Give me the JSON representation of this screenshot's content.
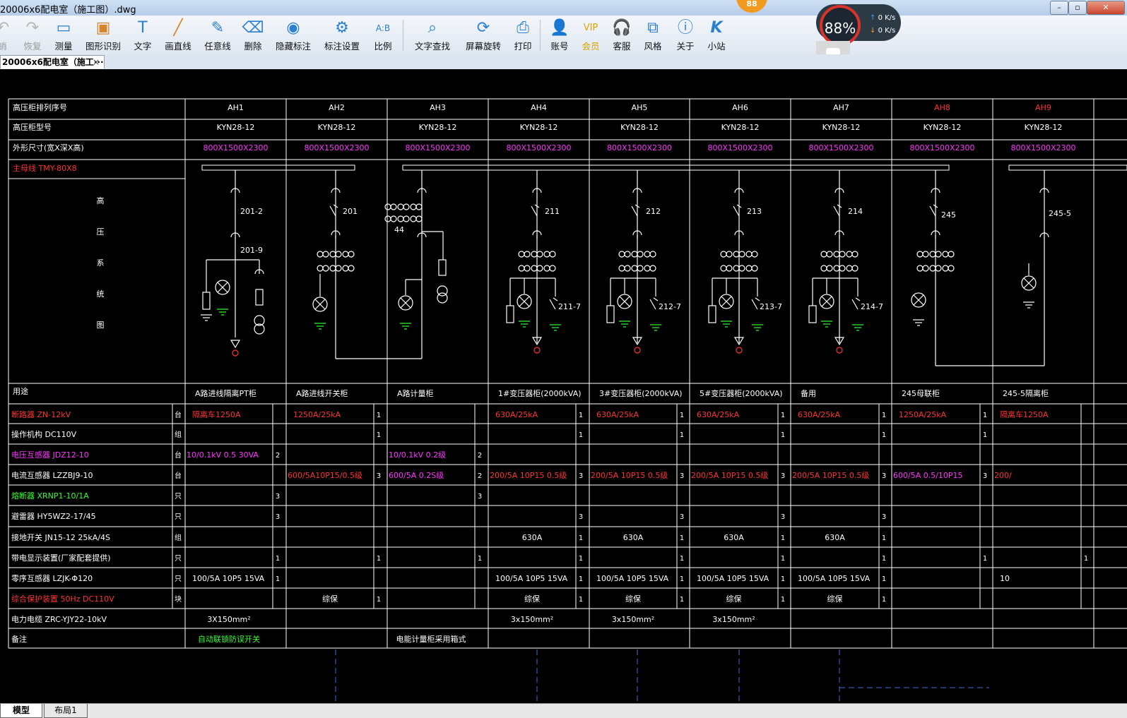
{
  "window": {
    "title": "20006x6配电室（施工图）.dwg"
  },
  "toolbar": {
    "undo": "撤销",
    "redo": "恢复",
    "measure": "测量",
    "shape_recog": "图形识别",
    "text": "文字",
    "draw_line": "画直线",
    "free_line": "任意线",
    "delete": "删除",
    "hide_anno": "隐藏标注",
    "anno_settings": "标注设置",
    "scale": "比例",
    "text_search": "文字查找",
    "rotate": "屏幕旋转",
    "print": "打印",
    "account": "账号",
    "vip": "会员",
    "service": "客服",
    "style": "风格",
    "about": "关于",
    "site": "小站"
  },
  "speed": {
    "percent": "88%",
    "up": "0 K/s",
    "down": "0 K/s",
    "badge": "88"
  },
  "tab": {
    "label": "20006x6配电室（施工···",
    "close": "×"
  },
  "layout_tabs": {
    "model": "模型",
    "layout1": "布局1"
  },
  "drawing": {
    "header": {
      "row1_label": "高压柜排列序号",
      "row2_label": "高压柜型号",
      "row3_label": "外形尺寸(宽X深X高)",
      "busbar_label": "主母线 TMY-80X8",
      "system_label": [
        "高",
        "压",
        "系",
        "统",
        "图"
      ],
      "cabinets": [
        "AH1",
        "AH2",
        "AH3",
        "AH4",
        "AH5",
        "AH6",
        "AH7",
        "AH8",
        "AH9"
      ],
      "model": "KYN28-12",
      "size": "800X1500X2300"
    },
    "device_labels": [
      "201-2",
      "201-9",
      "201",
      "44",
      "211",
      "211-7",
      "212",
      "212-7",
      "213",
      "213-7",
      "214",
      "214-7",
      "245",
      "245-5"
    ],
    "usage": {
      "label": "用途",
      "values": [
        "A路进线隔离PT柜",
        "A路进线开关柜",
        "A路计量柜",
        "1#变压器柜(2000kVA)",
        "3#变压器柜(2000kVA)",
        "5#变压器柜(2000kVA)",
        "备用",
        "245母联柜",
        "245-5隔离柜"
      ]
    },
    "rows": [
      {
        "label": "断路器 ZN-12kV",
        "unit": "台",
        "cells": [
          "隔离车1250A",
          "1250A/25kA",
          "",
          "630A/25kA",
          "630A/25kA",
          "630A/25kA",
          "630A/25kA",
          "1250A/25kA",
          "隔离车1250A"
        ],
        "qty": [
          "",
          "1",
          "",
          "1",
          "1",
          "1",
          "1",
          "1",
          ""
        ]
      },
      {
        "label": "操作机构 DC110V",
        "unit": "组",
        "cells": [
          "",
          "",
          "",
          "",
          "",
          "",
          "",
          "",
          ""
        ],
        "qty": [
          "",
          "1",
          "",
          "1",
          "1",
          "1",
          "1",
          "1",
          ""
        ]
      },
      {
        "label": "电压互感器 JDZ12-10",
        "unit": "台",
        "cells": [
          "10/0.1kV 0.5 30VA",
          "",
          "10/0.1kV 0.2级",
          "",
          "",
          "",
          "",
          "",
          ""
        ],
        "qty": [
          "2",
          "",
          "2",
          "",
          "",
          "",
          "",
          "",
          ""
        ]
      },
      {
        "label": "电流互感器 LZZBJ9-10",
        "unit": "台",
        "cells": [
          "",
          "600/5A10P15/0.5级",
          "600/5A 0.2S级",
          "200/5A 10P15 0.5级",
          "200/5A 10P15 0.5级",
          "200/5A 10P15 0.5级",
          "200/5A 10P15 0.5级",
          "600/5A 0.5/10P15",
          "200/"
        ],
        "qty": [
          "",
          "3",
          "2",
          "3",
          "3",
          "3",
          "3",
          "3",
          ""
        ]
      },
      {
        "label": "熔断器 XRNP1-10/1A",
        "unit": "只",
        "cells": [
          "",
          "",
          "",
          "",
          "",
          "",
          "",
          "",
          ""
        ],
        "qty": [
          "3",
          "",
          "3",
          "",
          "",
          "",
          "",
          "",
          ""
        ]
      },
      {
        "label": "避雷器 HY5WZ2-17/45",
        "unit": "只",
        "cells": [
          "",
          "",
          "",
          "",
          "",
          "",
          "",
          "",
          ""
        ],
        "qty": [
          "3",
          "",
          "",
          "3",
          "3",
          "3",
          "3",
          "",
          ""
        ]
      },
      {
        "label": "接地开关 JN15-12 25kA/4S",
        "unit": "组",
        "cells": [
          "",
          "",
          "",
          "630A",
          "630A",
          "630A",
          "630A",
          "",
          ""
        ],
        "qty": [
          "",
          "",
          "",
          "1",
          "1",
          "1",
          "1",
          "",
          ""
        ]
      },
      {
        "label": "带电显示装置(厂家配套提供)",
        "unit": "只",
        "cells": [
          "",
          "",
          "",
          "",
          "",
          "",
          "",
          "",
          ""
        ],
        "qty": [
          "1",
          "1",
          "1",
          "1",
          "1",
          "1",
          "1",
          "1",
          "1"
        ]
      },
      {
        "label": "零序互感器 LZJK-Φ120",
        "unit": "只",
        "cells": [
          "100/5A 10P5 15VA",
          "",
          "",
          "100/5A 10P5 15VA",
          "100/5A 10P5 15VA",
          "100/5A 10P5 15VA",
          "100/5A 10P5 15VA",
          "",
          "10"
        ],
        "qty": [
          "1",
          "",
          "",
          "1",
          "1",
          "1",
          "1",
          "",
          ""
        ]
      },
      {
        "label": "综合保护装置 50Hz DC110V",
        "unit": "块",
        "cells": [
          "",
          "综保",
          "",
          "综保",
          "综保",
          "综保",
          "综保",
          "",
          ""
        ],
        "qty": [
          "",
          "1",
          "",
          "1",
          "1",
          "1",
          "1",
          "",
          ""
        ]
      },
      {
        "label": "电力电缆 ZRC-YJY22-10kV",
        "unit": "",
        "cells": [
          "3X150mm²",
          "",
          "",
          "3x150mm²",
          "3x150mm²",
          "3x150mm²",
          "",
          "",
          ""
        ],
        "qty": [
          "",
          "",
          "",
          "",
          "",
          "",
          "",
          "",
          ""
        ]
      },
      {
        "label": "备注",
        "unit": "",
        "cells": [
          "自动联锁防误开关",
          "",
          "电能计量柜采用箱式",
          "",
          "",
          "",
          "",
          "",
          ""
        ],
        "qty": [
          "",
          "",
          "",
          "",
          "",
          "",
          "",
          "",
          ""
        ]
      }
    ]
  },
  "colors": {
    "line": "#ffffff",
    "magenta": "#ff33ff",
    "red": "#ff3333",
    "green": "#33ff33",
    "blue": "#3a6bd8"
  }
}
